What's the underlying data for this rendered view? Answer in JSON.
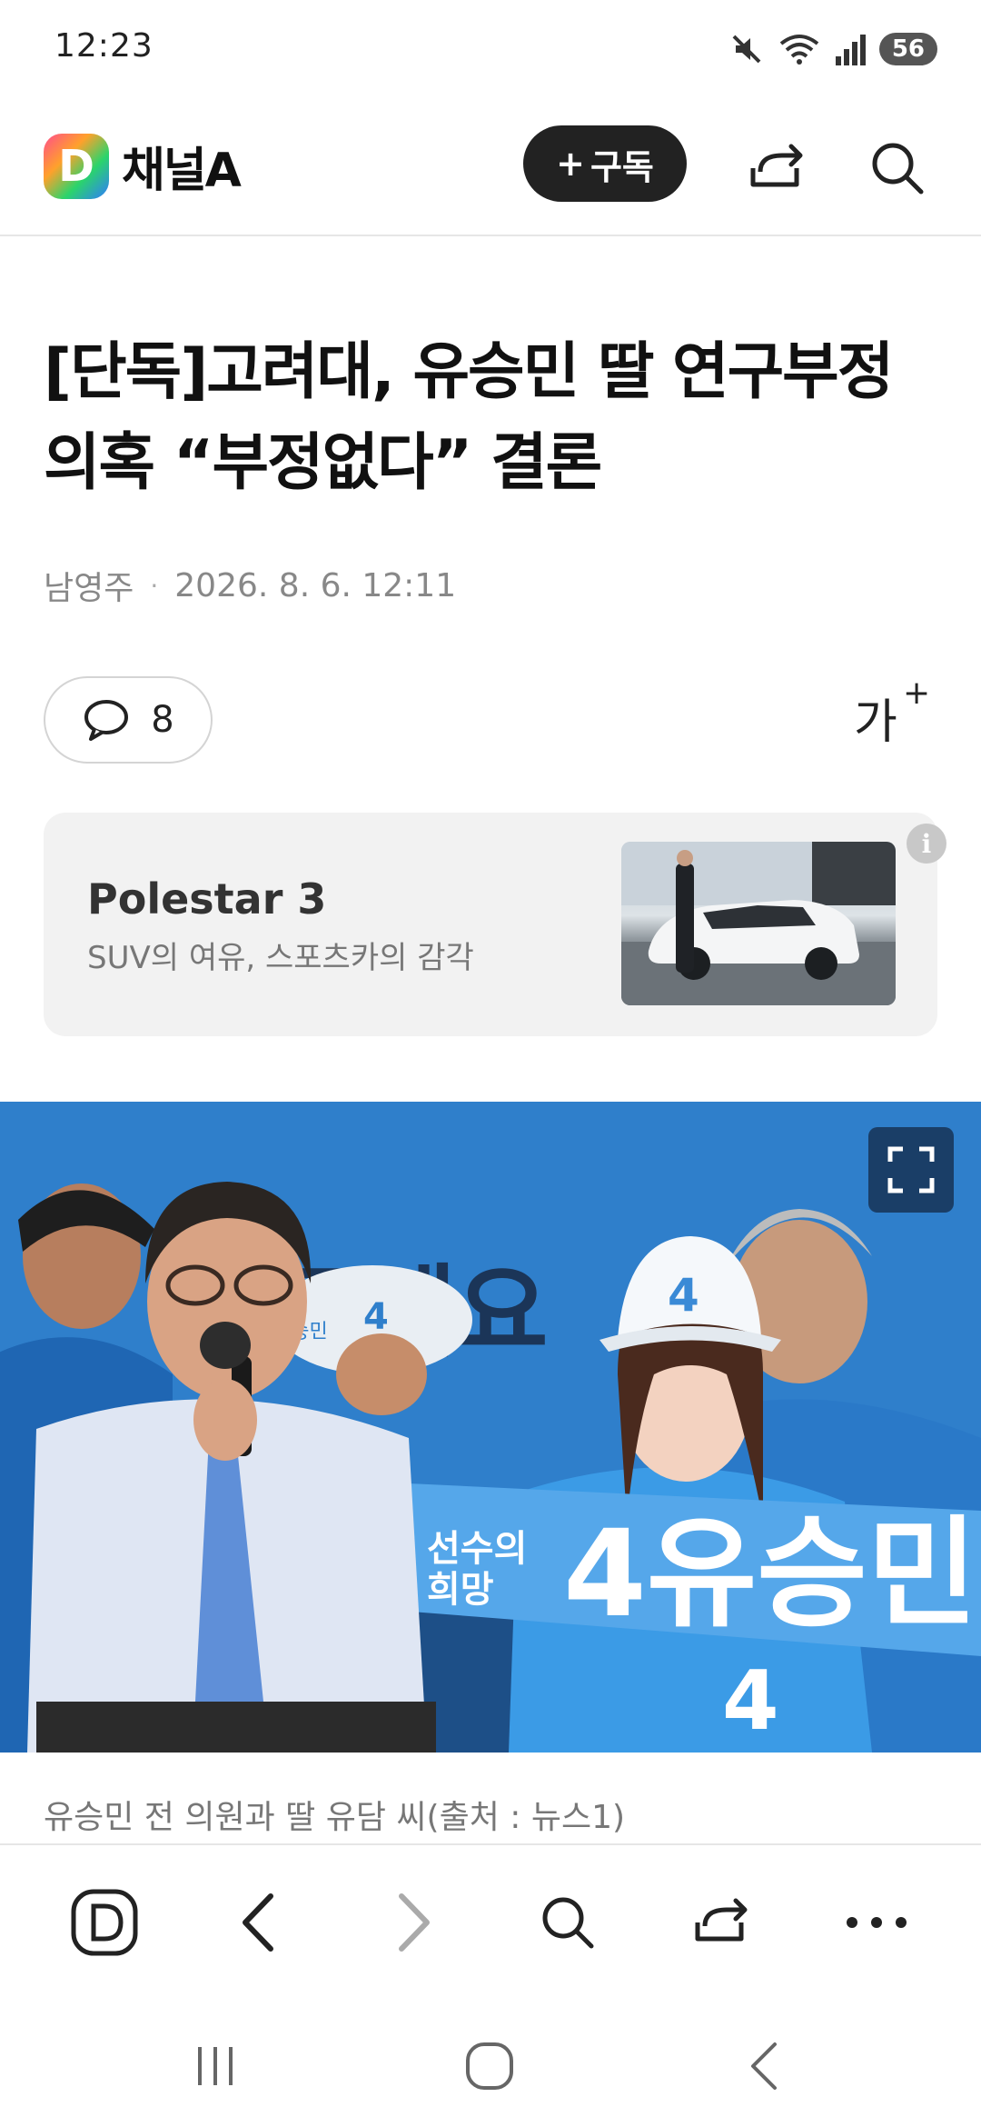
{
  "status_bar": {
    "time": "12:23",
    "battery": "56"
  },
  "header": {
    "brand_letter": "D",
    "brand_name": "채널A",
    "subscribe_label": "구독",
    "subscribe_plus": "+"
  },
  "article": {
    "headline": "[단독]고려대, 유승민 딸 연구부정 의혹 “부정없다” 결론",
    "author": "남영주",
    "timestamp": "2026. 8. 6. 12:11",
    "comment_count": "8",
    "font_size_label": "가",
    "font_size_plus": "+",
    "image_caption": "유승민 전 의원과 딸 유담 씨(출처 : 뉴스1)"
  },
  "ad": {
    "title": "Polestar 3",
    "subtitle": "SUV의 여유, 스포츠카의 감각",
    "info_glyph": "i"
  },
  "photo": {
    "banner_text": "4유승민",
    "banner_small_1": "선수의",
    "banner_small_2": "희망",
    "backdrop_text": "주세요",
    "cap_number": "4",
    "shirt_number": "4",
    "cap_text_left": "유승민"
  },
  "icons": {
    "status": [
      "mute-icon",
      "wifi-icon",
      "signal-icon",
      "battery-icon"
    ],
    "header": [
      "share-icon",
      "search-icon"
    ],
    "bottom_bar": [
      "channel-home-icon",
      "back-icon",
      "forward-icon",
      "search-icon",
      "share-icon",
      "more-icon"
    ],
    "system_nav": [
      "recent-apps-icon",
      "home-icon",
      "back-icon"
    ]
  },
  "colors": {
    "accent_dark": "#222222",
    "photo_blue": "#3a8ad6",
    "ad_bg": "#f2f2f2"
  }
}
